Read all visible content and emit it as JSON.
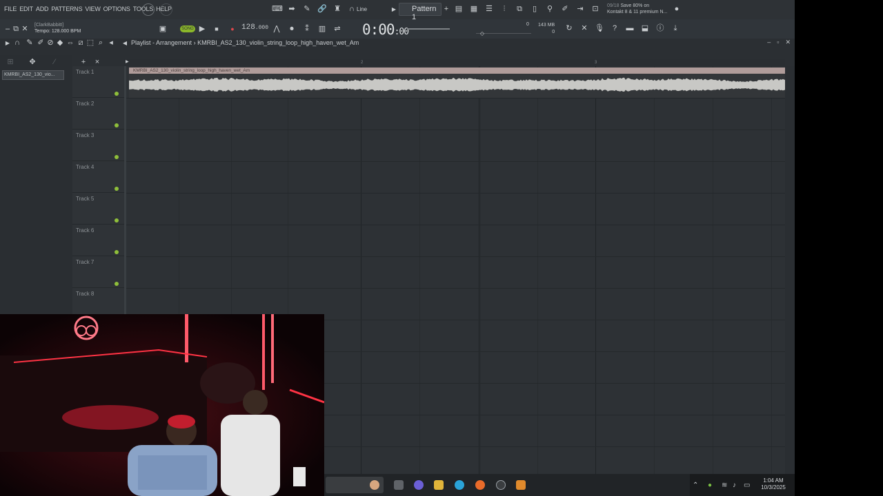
{
  "menu": {
    "items": [
      "FILE",
      "EDIT",
      "ADD",
      "PATTERNS",
      "VIEW",
      "OPTIONS",
      "TOOLS",
      "HELP"
    ]
  },
  "toolbar": {
    "snap": "Line",
    "pattern": "Pattern 1",
    "news_line1": "09/18",
    "news_text": "Save 80% on",
    "news_line2": "Kontakt 8 & 11 premium N..."
  },
  "transport": {
    "user": "[ClarkBabbitt]",
    "tempo_hint": "Tempo: 128.000 BPM",
    "song_mode": "SONG",
    "bpm": "128",
    "bpm_dec": ".000",
    "time": "0:00",
    "time_small": ":00",
    "memory": "143 MB",
    "mem_zero_a": "0",
    "mem_zero_b": "0"
  },
  "playlist": {
    "title": "Playlist - Arrangement",
    "sep": "›",
    "clip_name": "KMRBI_AS2_130_violin_string_loop_high_haven_wet_Am",
    "clip_header": "KMRBI_AS2_130_violin_string_loop_high_haven_wet_Am",
    "picker_item": "KMRBI_AS2_130_vio..."
  },
  "ruler": {
    "marks": [
      "2",
      "3"
    ]
  },
  "tracks": [
    {
      "label": "Track 1"
    },
    {
      "label": "Track 2"
    },
    {
      "label": "Track 3"
    },
    {
      "label": "Track 4"
    },
    {
      "label": "Track 5"
    },
    {
      "label": "Track 6"
    },
    {
      "label": "Track 7"
    },
    {
      "label": "Track 8"
    }
  ],
  "taskbar": {
    "time": "1:04 AM",
    "date": "10/3/2025"
  },
  "colors": {
    "accent_green": "#8fbf3a",
    "clip_header": "#b09c9a",
    "rec_red": "#e0474c"
  }
}
